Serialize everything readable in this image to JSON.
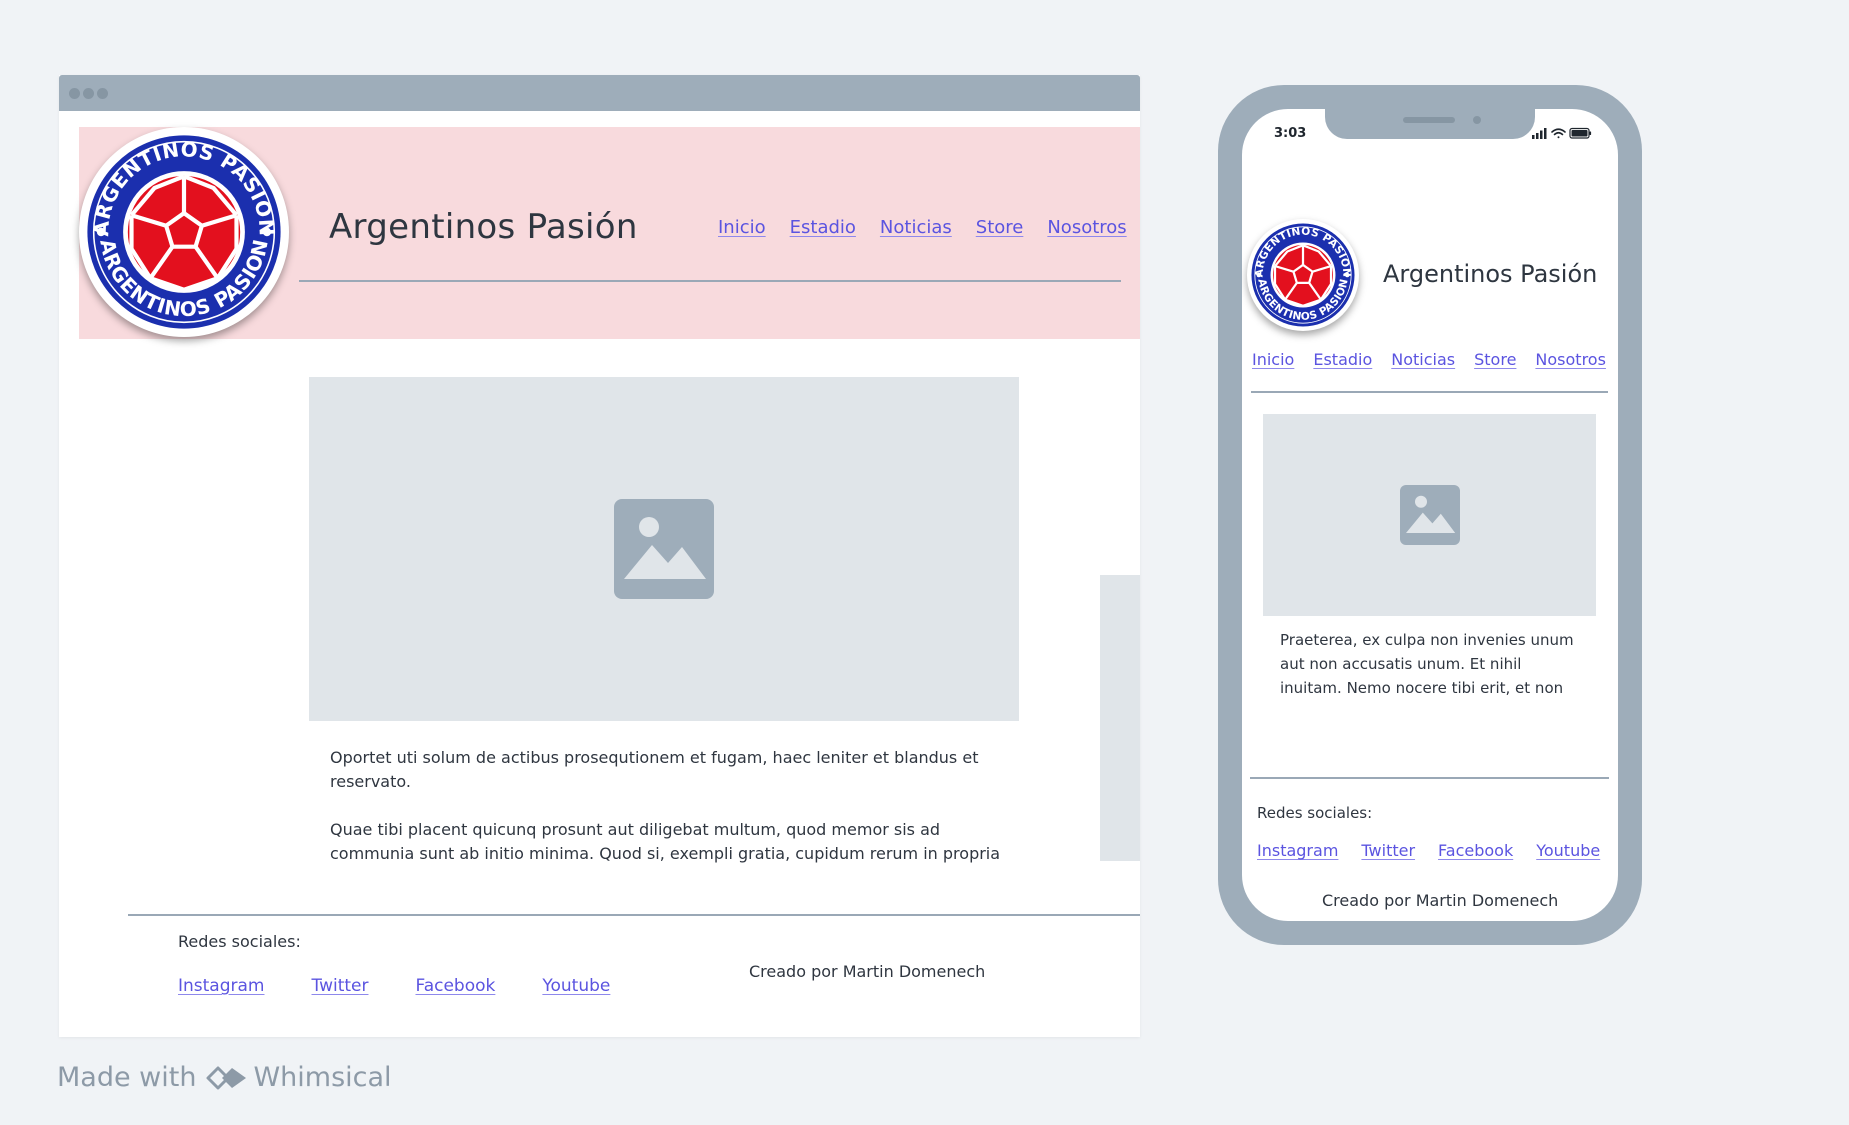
{
  "site": {
    "title": "Argentinos Pasión",
    "nav": [
      "Inicio",
      "Estadio",
      "Noticias",
      "Store",
      "Nosotros"
    ],
    "logo_text_top": "ARGENTINOS PASION",
    "logo_text_bottom": "ARGENTINOS PASION"
  },
  "desktop": {
    "paragraphs": [
      "Oportet uti solum de actibus prosequtionem et fugam, haec leniter et blandus et reservato.",
      "Quae tibi placent quicunq prosunt aut diligebat multum, quod memor sis ad communia sunt ab initio minima. Quod si, exempli gratia, cupidum rerum in propria"
    ]
  },
  "mobile": {
    "time": "3:03",
    "paragraph": "Praeterea, ex culpa non invenies unum aut non accusatis unum. Et nihil inuitam. Nemo nocere tibi erit, et non"
  },
  "footer": {
    "social_label": "Redes sociales:",
    "social_links": [
      "Instagram",
      "Twitter",
      "Facebook",
      "Youtube"
    ],
    "credit": "Creado por Martin Domenech"
  },
  "watermark": {
    "made_with": "Made with",
    "brand": "Whimsical"
  },
  "colors": {
    "header_bg": "#f8dadd",
    "frame": "#9eadba",
    "link": "#5b54e0",
    "placeholder": "#e0e5e9",
    "background": "#f0f3f6"
  }
}
